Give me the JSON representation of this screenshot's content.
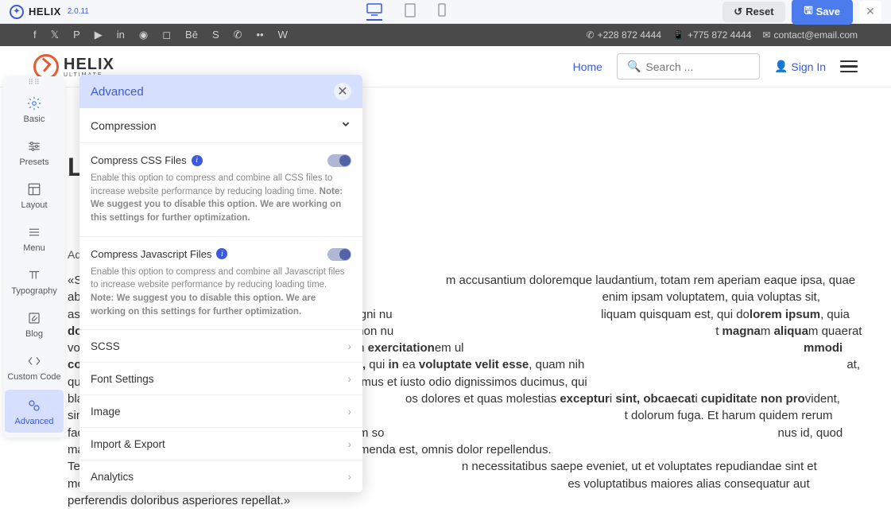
{
  "topbar": {
    "logo_text": "HELIX",
    "logo_version": "2.0.11",
    "reset_label": "Reset",
    "save_label": "Save"
  },
  "contact": {
    "phone1": "+228 872 4444",
    "phone2": "+775 872 4444",
    "email": "contact@email.com"
  },
  "site": {
    "brand": "HELIX",
    "brand_sub": "ULTIMATE",
    "nav_home": "Home",
    "search_placeholder": "Search ...",
    "signin": "Sign In"
  },
  "sidebar": {
    "items": [
      {
        "label": "Basic"
      },
      {
        "label": "Presets"
      },
      {
        "label": "Layout"
      },
      {
        "label": "Menu"
      },
      {
        "label": "Typography"
      },
      {
        "label": "Blog"
      },
      {
        "label": "Custom Code"
      },
      {
        "label": "Advanced"
      }
    ]
  },
  "panel": {
    "title": "Advanced",
    "compression_header": "Compression",
    "css_label": "Compress CSS Files",
    "css_desc_pre": "Enable this option to compress and combine all CSS files to increase website performance by reducing loading time. ",
    "css_desc_bold": "Note: We suggest you to disable this option. We are working on this settings for further optimization.",
    "js_label": "Compress Javascript Files",
    "js_desc_pre": "Enable this option to compress and combine all Javascript files to increase website performance by reducing loading time. ",
    "js_desc_bold": "Note: We suggest you to disable this option. We are working on this settings for further optimization.",
    "items": [
      {
        "label": "SCSS"
      },
      {
        "label": "Font Settings"
      },
      {
        "label": "Image"
      },
      {
        "label": "Import & Export"
      },
      {
        "label": "Analytics"
      }
    ]
  },
  "content": {
    "heading_prefix": "Lo",
    "sub_prefix": "Ad"
  }
}
